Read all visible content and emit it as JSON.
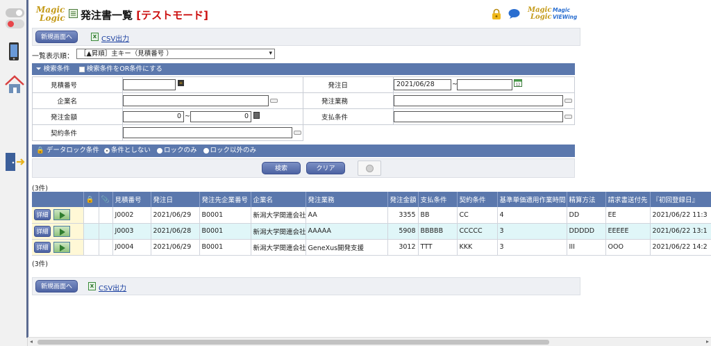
{
  "rail": {
    "icons": [
      "toggle-switch-icon",
      "toggle-switch-icon",
      "mobile-phone-icon",
      "home-icon",
      "exit-door-icon"
    ]
  },
  "header": {
    "logo_line1": "Magic",
    "logo_line2": "Logic",
    "title": "発注書一覧",
    "mode": "[テストモード]",
    "right_logo_line1": "Magic",
    "right_logo_line2": "Logic",
    "viewing_line1": "Magic",
    "viewing_line2": "VIEWing"
  },
  "toolbar_top": {
    "new_button": "新規画面へ",
    "csv_link": "CSV出力"
  },
  "sort": {
    "label": "一覧表示順：",
    "selected": "［▲昇順］主キー（見積番号 ）"
  },
  "search_bar": {
    "title": "検索条件",
    "or_option": "検索条件をOR条件にする"
  },
  "search": {
    "estimate_no_label": "見積番号",
    "estimate_no_value": "",
    "order_date_label": "発注日",
    "order_date_from": "2021/06/28",
    "order_date_to": "",
    "company_label": "企業名",
    "company_value": "",
    "work_label": "発注業務",
    "work_value": "",
    "amount_label": "発注金額",
    "amount_from": "0",
    "amount_to": "0",
    "payment_label": "支払条件",
    "payment_value": "",
    "contract_label": "契約条件",
    "contract_value": ""
  },
  "lock_bar": {
    "title": "データロック条件",
    "options": [
      "条件としない",
      "ロックのみ",
      "ロック以外のみ"
    ],
    "selected": 0
  },
  "actions": {
    "search": "検索",
    "clear": "クリア"
  },
  "count_top": "(3件)",
  "count_bottom": "(3件)",
  "grid": {
    "columns": [
      "見積番号",
      "発注日",
      "発注先企業番号",
      "企業名",
      "発注業務",
      "発注金額",
      "支払条件",
      "契約条件",
      "基準単価適用作業時間",
      "精算方法",
      "請求書送付先",
      "『初回登録日』"
    ],
    "detail_label": "詳細",
    "rows": [
      [
        "J0002",
        "2021/06/29",
        "B0001",
        "新潟大学関連会社",
        "AA",
        "3355",
        "BB",
        "CC",
        "4",
        "DD",
        "EE",
        "2021/06/22 11:3"
      ],
      [
        "J0003",
        "2021/06/28",
        "B0001",
        "新潟大学関連会社",
        "AAAAA",
        "5908",
        "BBBBB",
        "CCCCC",
        "3",
        "DDDDD",
        "EEEEE",
        "2021/06/22 13:1"
      ],
      [
        "J0004",
        "2021/06/29",
        "B0001",
        "新潟大学関連会社",
        "GeneXus開発支援",
        "3012",
        "TTT",
        "KKK",
        "3",
        "III",
        "OOO",
        "2021/06/22 14:2"
      ]
    ]
  },
  "toolbar_bottom": {
    "new_button": "新規画面へ",
    "csv_link": "CSV出力"
  },
  "colors": {
    "header_bar": "#5b78ad",
    "button": "#4d63a3",
    "alt_row": "#e0f6f8",
    "test_mode": "#cc1010"
  }
}
